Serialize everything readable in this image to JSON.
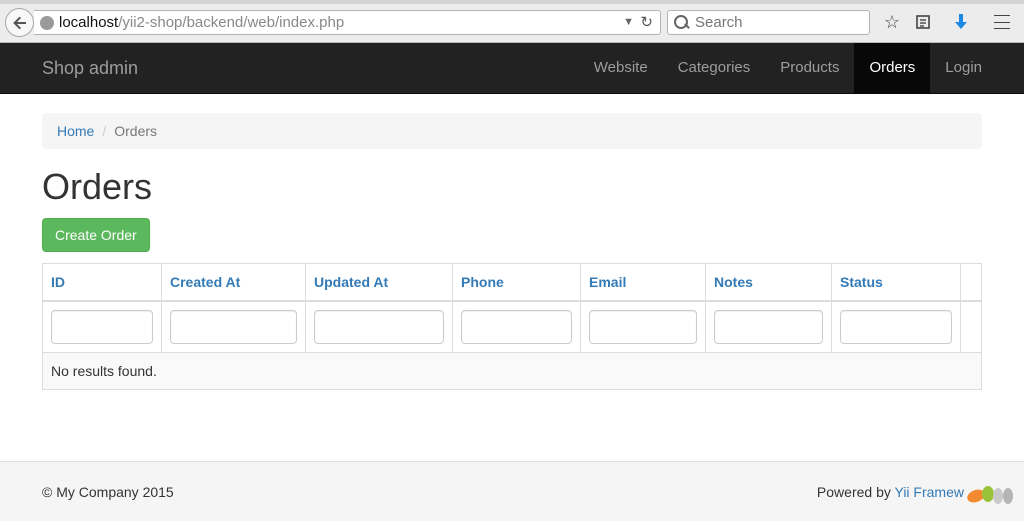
{
  "browser": {
    "url_host": "localhost",
    "url_path": "/yii2-shop/backend/web/index.php",
    "search_placeholder": "Search"
  },
  "navbar": {
    "brand": "Shop admin",
    "items": [
      {
        "label": "Website",
        "active": false
      },
      {
        "label": "Categories",
        "active": false
      },
      {
        "label": "Products",
        "active": false
      },
      {
        "label": "Orders",
        "active": true
      },
      {
        "label": "Login",
        "active": false
      }
    ]
  },
  "breadcrumb": {
    "home": "Home",
    "separator": "/",
    "current": "Orders"
  },
  "page": {
    "title": "Orders",
    "create_button": "Create Order"
  },
  "grid": {
    "columns": [
      "ID",
      "Created At",
      "Updated At",
      "Phone",
      "Email",
      "Notes",
      "Status"
    ],
    "empty_text": "No results found."
  },
  "footer": {
    "copyright": "© My Company 2015",
    "powered_prefix": "Powered by ",
    "powered_link": "Yii Framew"
  },
  "colors": {
    "navbar_bg": "#222222",
    "link": "#337ab7",
    "success": "#5cb85c"
  }
}
